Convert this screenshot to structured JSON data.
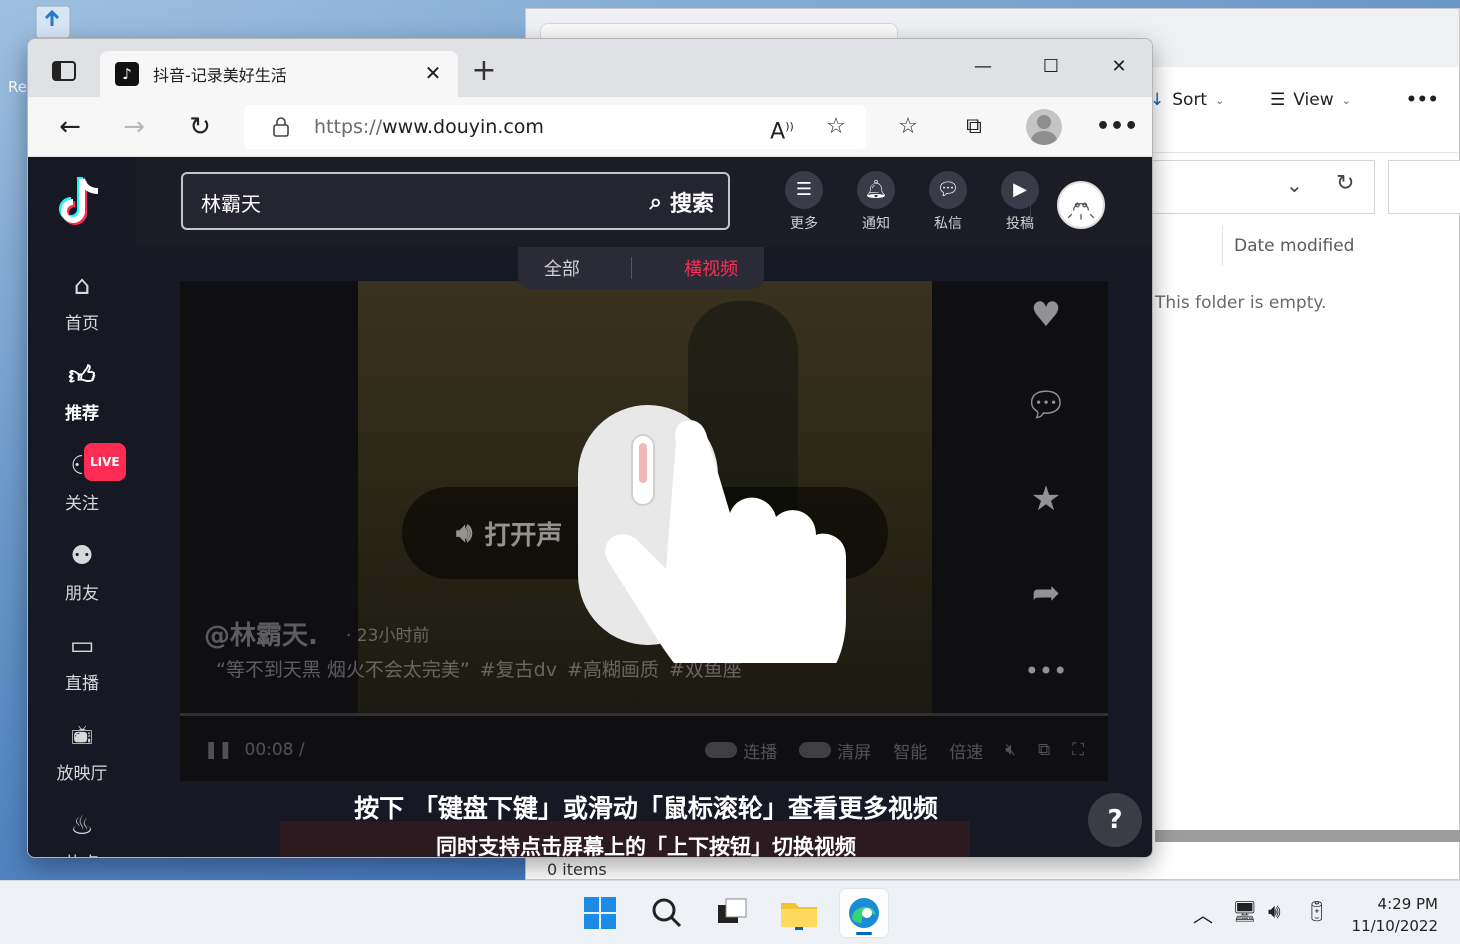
{
  "desktop": {
    "icon_label": "Re"
  },
  "explorer": {
    "sort_label": "Sort",
    "view_label": "View",
    "more_label": "•••",
    "column_date_modified": "Date modified",
    "empty_message": "This folder is empty.",
    "status_items": "0 items"
  },
  "browser": {
    "tab_title": "抖音-记录美好生活",
    "url_prefix": "https://",
    "url_rest": "www.douyin.com",
    "more_label": "•••"
  },
  "douyin": {
    "search_value": "林霸天",
    "search_button": "搜索",
    "header_buttons": [
      {
        "label": "更多",
        "icon": "menu-icon"
      },
      {
        "label": "通知",
        "icon": "bell-icon"
      },
      {
        "label": "私信",
        "icon": "message-icon"
      },
      {
        "label": "投稿",
        "icon": "video-upload-icon"
      }
    ],
    "sidebar": [
      {
        "label": "首页",
        "icon": "home-icon"
      },
      {
        "label": "推荐",
        "icon": "thumbs-up-icon",
        "active": true
      },
      {
        "label": "关注",
        "icon": "add-user-icon",
        "badge": "LIVE"
      },
      {
        "label": "朋友",
        "icon": "friends-icon"
      },
      {
        "label": "直播",
        "icon": "live-icon"
      },
      {
        "label": "放映厅",
        "icon": "tv-icon"
      },
      {
        "label": "热点",
        "icon": "fire-icon"
      }
    ],
    "tabs": {
      "all": "全部",
      "landscape": "横视频"
    },
    "video": {
      "sound_button": "打开声",
      "author": "@林霸天.",
      "time": "· 23小时前",
      "desc": "“等不到天黑 烟火不会太完美”",
      "tags": [
        "#复古dv",
        "#高糊画质",
        "#双鱼座"
      ],
      "current_time": "00:08 /",
      "controls": [
        "连播",
        "清屏",
        "智能",
        "倍速"
      ]
    },
    "guide": {
      "line1": "按下 「键盘下键」或滑动「鼠标滚轮」查看更多视频",
      "line2": "同时支持点击屏幕上的「上下按钮」切换视频"
    },
    "help": "?"
  },
  "taskbar": {
    "time": "4:29 PM",
    "date": "11/10/2022"
  },
  "colors": {
    "douyin_red": "#fe2c55",
    "douyin_bg": "#161823",
    "edge_blue": "#0067c0"
  }
}
